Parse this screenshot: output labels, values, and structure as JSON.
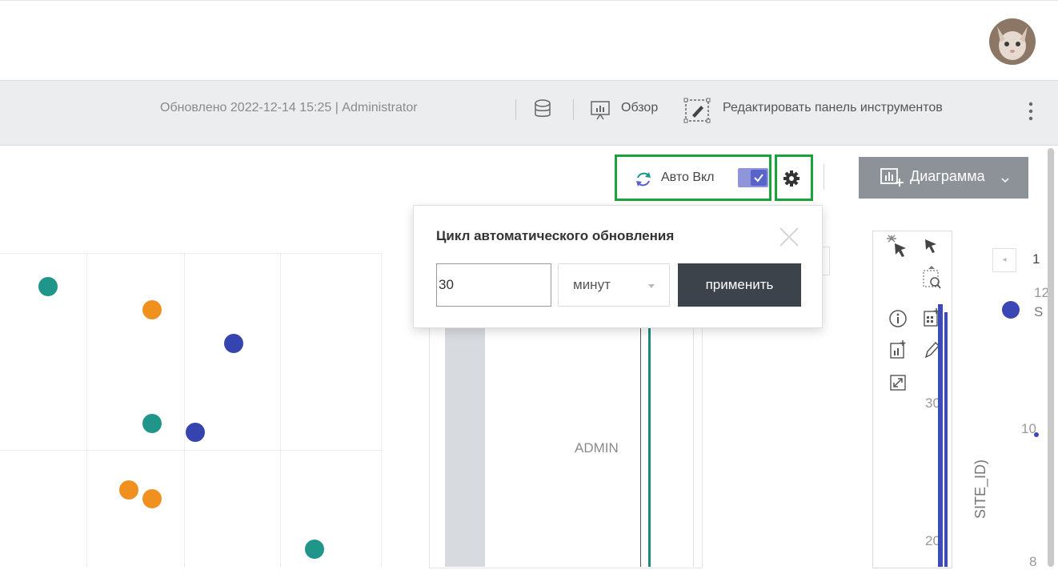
{
  "header": {
    "user_avatar": "avatar"
  },
  "toolbar": {
    "updated_label": "Обновлено",
    "updated_time": "2022-12-14 15:25",
    "updated_user": "| Administrator",
    "overview_label": "Обзор",
    "edit_label": "Редактировать панель инструментов",
    "more_icon": "more-vertical-icon"
  },
  "controls": {
    "auto_label": "Авто Вкл",
    "auto_enabled": true,
    "chart_button_label": "Диаграмма"
  },
  "popup": {
    "title": "Цикл автоматического обновления",
    "interval_value": "30",
    "unit_selected": "минут",
    "apply_label": "применить"
  },
  "panel": {
    "admin_label": "ADMIN",
    "axis_labels": [
      "30",
      "20"
    ],
    "right_axis_labels": [
      "12",
      "10",
      "8"
    ],
    "right_axis_title": "SITE_ID)",
    "page_num": "1",
    "legend_partial": "S"
  },
  "colors": {
    "teal": "#1f9689",
    "orange": "#f0911f",
    "blue": "#3644b0",
    "highlight_green": "#1aa33a"
  },
  "chart_data": {
    "type": "scatter",
    "series": [
      {
        "color": "#1f9689",
        "points": [
          [
            1,
            12
          ],
          [
            3.2,
            6
          ],
          [
            6.6,
            0.5
          ]
        ]
      },
      {
        "color": "#f0911f",
        "points": [
          [
            3.2,
            11
          ],
          [
            2.7,
            3.1
          ],
          [
            3.2,
            2.7
          ]
        ]
      },
      {
        "color": "#3644b0",
        "points": [
          [
            4.9,
            9.5
          ],
          [
            4.1,
            5.6
          ]
        ]
      }
    ]
  }
}
